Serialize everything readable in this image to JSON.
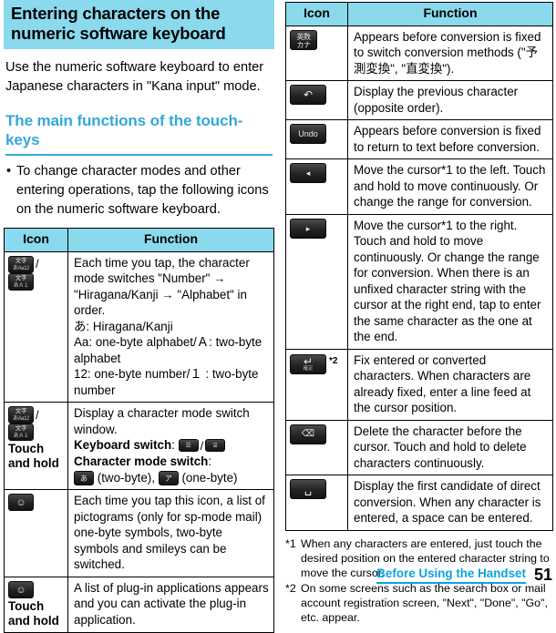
{
  "page": {
    "number": "51",
    "chapter_link": "Before Using the Handset"
  },
  "title": {
    "line1": "Entering characters on the",
    "line2": "numeric software keyboard",
    "banner_color": "#8ad9ec"
  },
  "intro": "Use the numeric software keyboard to enter Japanese characters in \"Kana input\" mode.",
  "section": {
    "heading": "The main functions of the touch-keys",
    "heading_color": "#35a8d8",
    "bullet": "To change character modes and other entering operations, tap the following icons on the numeric software keyboard."
  },
  "table": {
    "header_icon": "Icon",
    "header_function": "Function"
  },
  "left_rows": [
    {
      "icon_kind": "mode-pair",
      "icon_note": "",
      "lines": [
        "Each time you tap, the character mode switches \"Number\" → \"Hiragana/Kanji → \"Alphabet\" in order.",
        "あ: Hiragana/Kanji",
        "Aa: one-byte alphabet/Ａ: two-byte alphabet",
        "12: one-byte number/１ : two-byte number"
      ]
    },
    {
      "icon_kind": "mode-pair",
      "icon_note": "Touch and hold",
      "lines": [
        "Display a character mode switch window."
      ],
      "extra": {
        "keyboard_switch_label": "Keyboard switch",
        "character_mode_switch_label": "Character mode switch",
        "two_byte_label": "(two-byte),",
        "one_byte_label": "(one-byte)"
      }
    },
    {
      "icon_kind": "emoji",
      "icon_note": "",
      "lines": [
        "Each time you tap this icon, a list of pictograms (only for sp-mode mail) one-byte symbols, two-byte symbols and smileys can be switched."
      ]
    },
    {
      "icon_kind": "emoji",
      "icon_note": "Touch and hold",
      "lines": [
        "A list of plug-in applications appears and you can activate the plug-in application."
      ]
    }
  ],
  "right_rows": [
    {
      "icon_kind": "kana-alnum",
      "icon_sup": "",
      "lines": [
        "Appears before conversion is fixed to switch conversion methods (\"予測変換\", \"直変換\")."
      ]
    },
    {
      "icon_kind": "back-arrow",
      "icon_sup": "",
      "lines": [
        "Display the previous character (opposite order)."
      ]
    },
    {
      "icon_kind": "undo",
      "icon_sup": "",
      "lines": [
        "Appears before conversion is fixed to return to text before conversion."
      ]
    },
    {
      "icon_kind": "cursor-left",
      "icon_sup": "",
      "lines": [
        "Move the cursor*1 to the left. Touch and hold to move continuously. Or change the range for conversion."
      ]
    },
    {
      "icon_kind": "cursor-right",
      "icon_sup": "",
      "lines": [
        "Move the cursor*1 to the right. Touch and hold to move continuously. Or change the range for conversion. When there is an unfixed character string with the cursor at the right end, tap to enter the same character as the one at the end."
      ]
    },
    {
      "icon_kind": "enter",
      "icon_sup": "*2",
      "lines": [
        "Fix entered or converted characters. When characters are already fixed, enter a line feed at the cursor position."
      ]
    },
    {
      "icon_kind": "backspace",
      "icon_sup": "",
      "lines": [
        "Delete the character before the cursor. Touch and hold to delete characters continuously."
      ]
    },
    {
      "icon_kind": "space",
      "icon_sup": "",
      "lines": [
        "Display the first candidate of direct conversion. When any character is entered, a space can be entered."
      ]
    }
  ],
  "footnotes": [
    {
      "mark": "*1",
      "text": "When any characters are entered, just touch the desired position on the entered character string to move the cursor."
    },
    {
      "mark": "*2",
      "text": "On some screens such as the search box or mail account registration screen, \"Next\", \"Done\", \"Go\", etc. appear."
    }
  ],
  "icon_glyphs": {
    "mode_kana": {
      "r1": "文字",
      "r2": "あAa12"
    },
    "mode_alpha": {
      "r1": "文字",
      "r2": "あＡ１"
    },
    "kana_alnum": {
      "r1": "英数",
      "r2": "カナ"
    },
    "back_arrow": "↶",
    "undo": "Undo",
    "cursor_left": "◂",
    "cursor_right": "▸",
    "enter": {
      "r1": "↵",
      "r2": "確定"
    },
    "backspace": "⌫",
    "space": "␣",
    "emoji": "☺",
    "kb_numeric": "☰",
    "kb_qwerty": "⌸",
    "mode_two_byte": "あ",
    "mode_one_byte": "ア"
  }
}
